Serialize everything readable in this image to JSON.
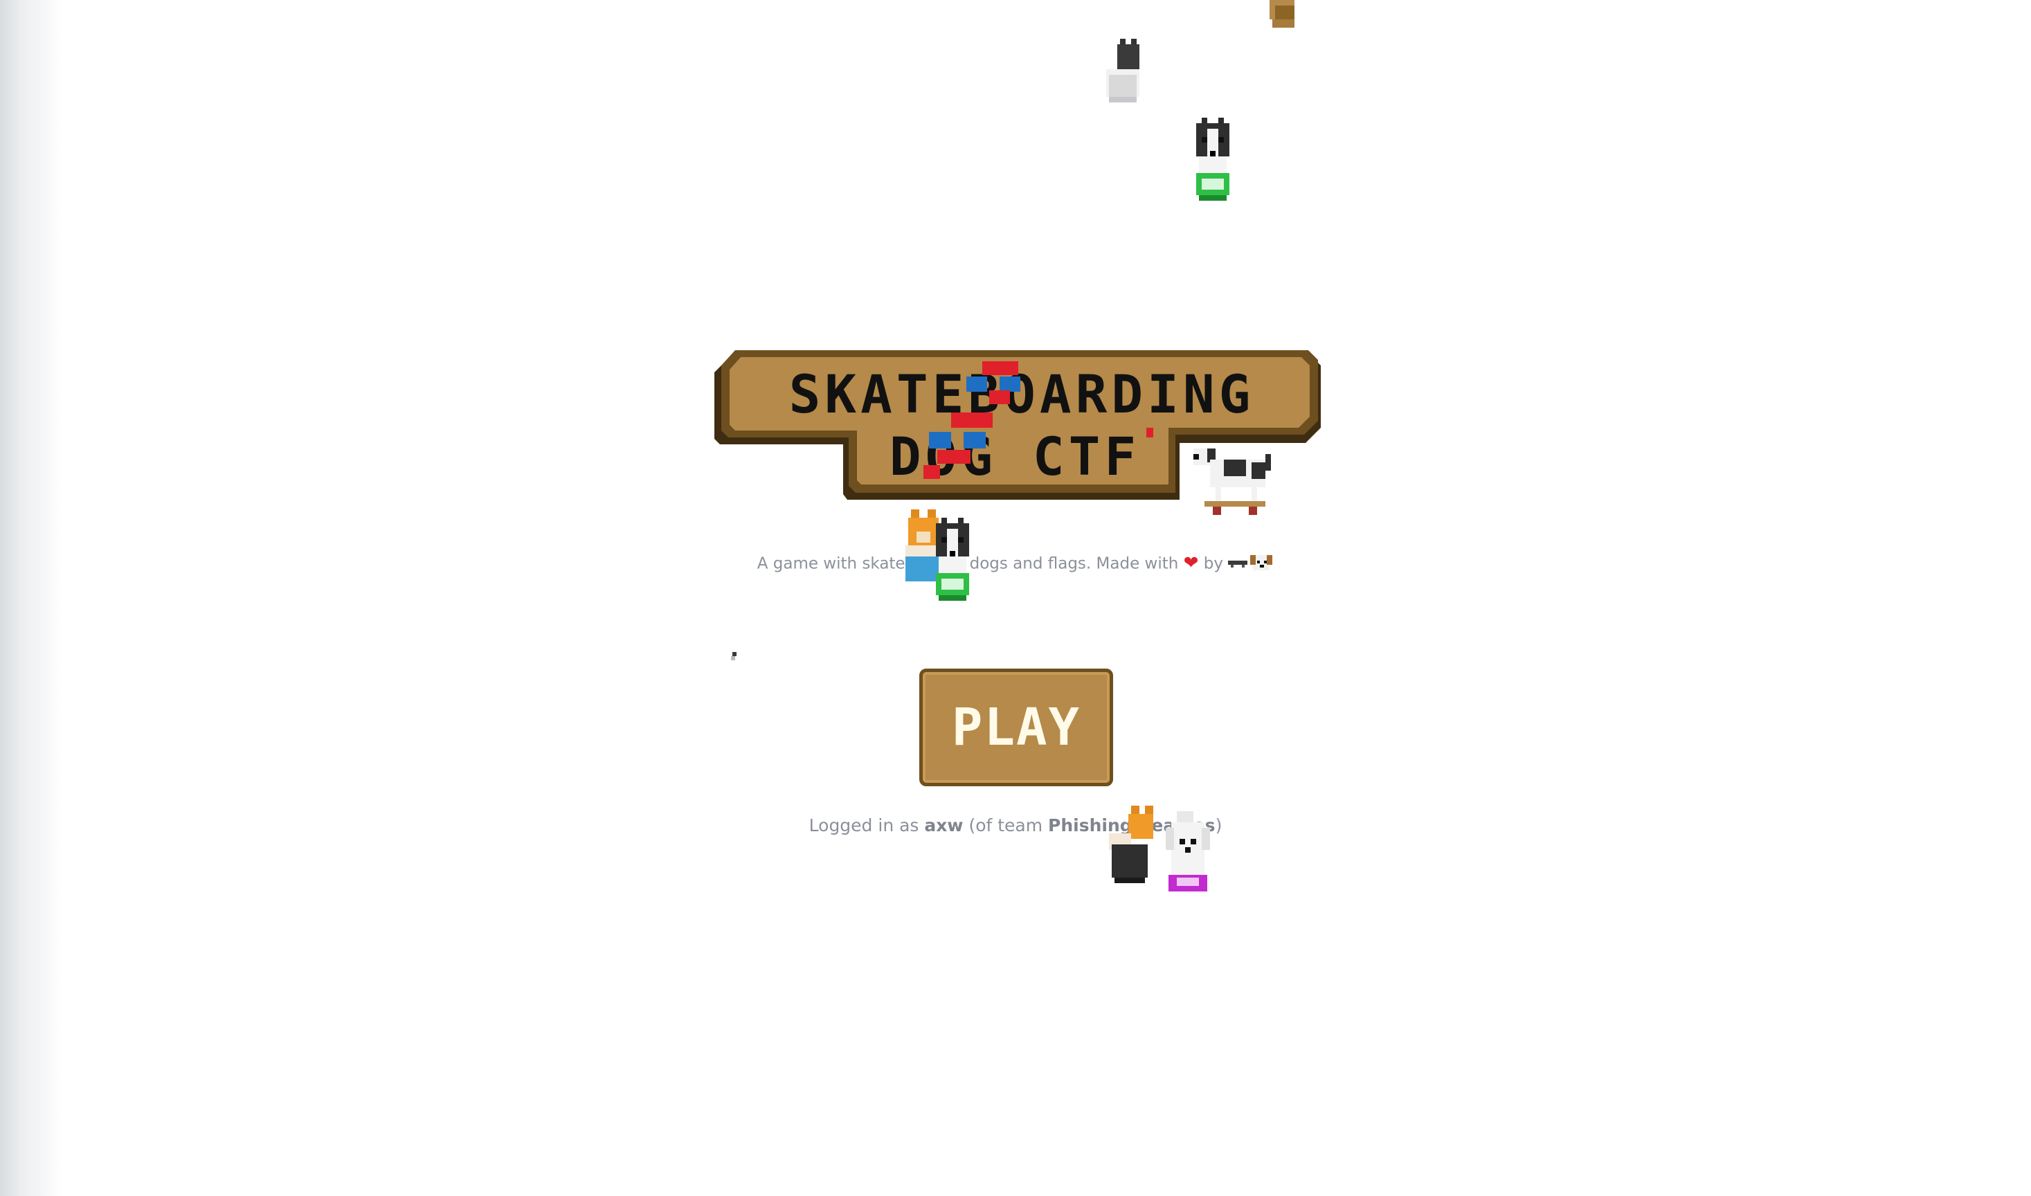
{
  "game": {
    "title_line1": "SKATEBOARDING",
    "title_line2": "DOG CTF",
    "tagline_prefix": "A game with skateboards, dogs and flags. Made with",
    "tagline_by": "by",
    "heart_icon": "heart-icon",
    "play_label": "PLAY"
  },
  "session": {
    "prefix": "Logged in as ",
    "username": "axw",
    "team_prefix": " (of team ",
    "team": "Phishing Beagles",
    "suffix": ")"
  },
  "colors": {
    "logo_fill": "#b58a4a",
    "logo_border": "#6e4f1f",
    "logo_shadow": "#3f2d12",
    "accent_red": "#e0202a",
    "accent_blue": "#1e6fc4",
    "text_muted": "#8b909a",
    "button_text": "#fffbe8"
  },
  "sprites": [
    {
      "name": "dog-sprite",
      "kind": "black-white-dog"
    },
    {
      "name": "dog-sprite",
      "kind": "black-dog-green-board"
    },
    {
      "name": "dog-sprite",
      "kind": "orange-cat"
    },
    {
      "name": "dog-sprite",
      "kind": "white-poodle-purple-board"
    },
    {
      "name": "dog-sprite",
      "kind": "skateboarding-dog"
    }
  ]
}
